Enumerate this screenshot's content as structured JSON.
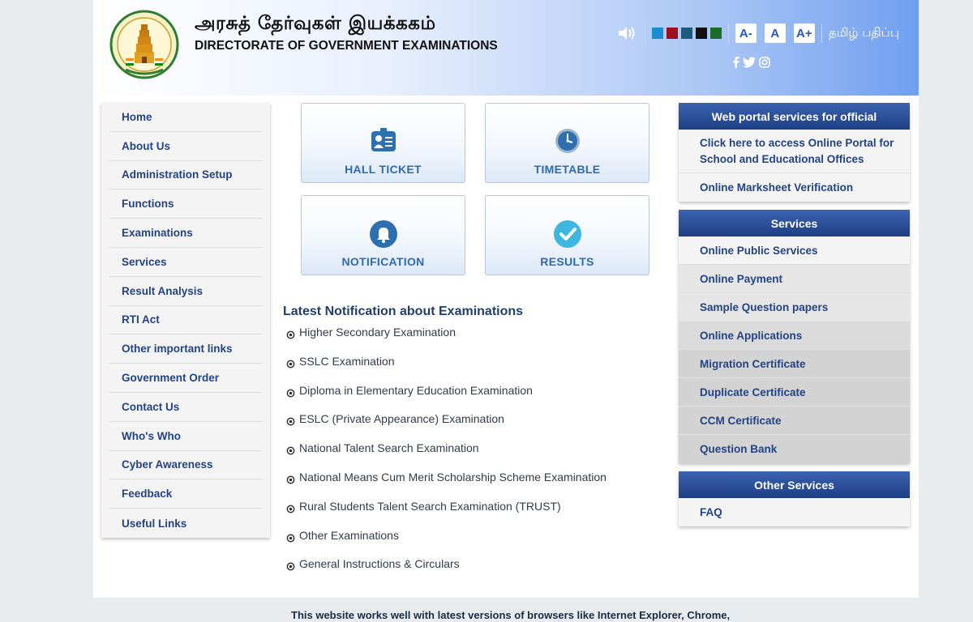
{
  "header": {
    "title_tamil": "அரசுத் தேர்வுகள் இயக்ககம்",
    "title_english": "DIRECTORATE OF GOVERNMENT EXAMINATIONS",
    "font_decrease": "A-",
    "font_normal": "A",
    "font_increase": "A+",
    "language_toggle": "தமிழ் பதிப்பு",
    "theme_colors": [
      "#1a8ccf",
      "#9b0f1e",
      "#1f5a7e",
      "#111111",
      "#1c6b2a"
    ]
  },
  "leftnav": {
    "items": [
      {
        "label": "Home"
      },
      {
        "label": "About Us"
      },
      {
        "label": "Administration Setup"
      },
      {
        "label": "Functions"
      },
      {
        "label": "Examinations"
      },
      {
        "label": "Services"
      },
      {
        "label": "Result Analysis"
      },
      {
        "label": "RTI Act"
      },
      {
        "label": "Other important links"
      },
      {
        "label": "Government Order"
      },
      {
        "label": "Contact Us"
      },
      {
        "label": "Who's Who"
      },
      {
        "label": "Cyber Awareness"
      },
      {
        "label": "Feedback"
      },
      {
        "label": "Useful Links"
      }
    ]
  },
  "tiles": {
    "hall_ticket": "HALL TICKET",
    "timetable": "TIMETABLE",
    "notification": "NOTIFICATION",
    "results": "RESULTS"
  },
  "notifications": {
    "title": "Latest Notification about Examinations",
    "items": [
      "Higher Secondary Examination",
      "SSLC Examination",
      "Diploma in Elementary Education Examination",
      "ESLC (Private Appearance) Examination",
      "National Talent Search Examination",
      "National Means Cum Merit Scholarship Scheme Examination",
      "Rural Students Talent Search Examination (TRUST)",
      "Other Examinations",
      "General Instructions & Circulars"
    ]
  },
  "portal": {
    "title": "Web portal services for official",
    "items": [
      "Click here to access Online Portal for School and Educational Offices",
      "Online Marksheet Verification"
    ]
  },
  "services": {
    "title": "Services",
    "items": [
      "Online Public Services",
      "Online Payment",
      "Sample Question papers",
      "Online Applications",
      "Migration Certificate",
      "Duplicate Certificate",
      "CCM Certificate",
      "Question Bank"
    ]
  },
  "other_services": {
    "title": "Other Services",
    "items": [
      "FAQ"
    ]
  },
  "footer": {
    "text": "This website works well with latest versions of browsers like Internet Explorer, Chrome,"
  }
}
